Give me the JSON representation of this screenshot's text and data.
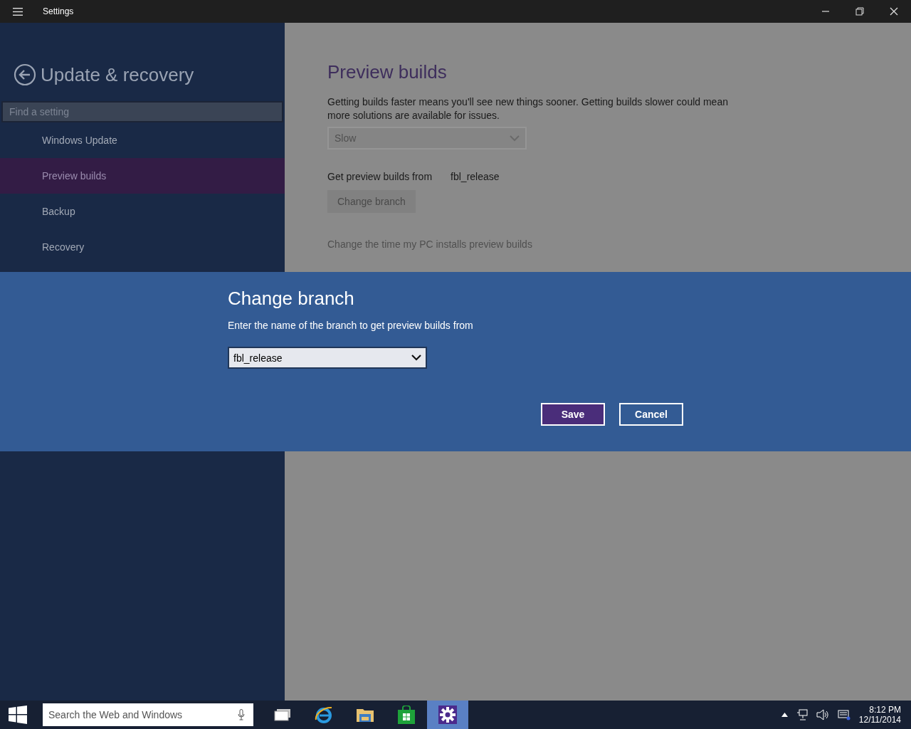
{
  "window": {
    "title": "Settings"
  },
  "sidebar": {
    "heading": "Update & recovery",
    "search": {
      "placeholder": "Find a setting"
    },
    "items": [
      {
        "label": "Windows Update",
        "selected": false
      },
      {
        "label": "Preview builds",
        "selected": true
      },
      {
        "label": "Backup",
        "selected": false
      },
      {
        "label": "Recovery",
        "selected": false
      }
    ]
  },
  "content": {
    "heading": "Preview builds",
    "description": "Getting builds faster means you'll see new things sooner. Getting builds slower could mean more solutions are available for issues.",
    "speed": {
      "value": "Slow",
      "disabled": true
    },
    "branch_label": "Get preview builds from",
    "branch_value": "fbl_release",
    "change_button": {
      "label": "Change branch",
      "disabled": true
    },
    "time_link": "Change the time my PC installs preview builds"
  },
  "dialog": {
    "title": "Change branch",
    "prompt": "Enter the name of the branch to get preview builds from",
    "branch": "fbl_release",
    "buttons": [
      {
        "label": "Save",
        "kind": "primary"
      },
      {
        "label": "Cancel",
        "kind": "secondary"
      }
    ]
  },
  "taskbar": {
    "search": {
      "placeholder": "Search the Web and Windows"
    },
    "apps": [
      {
        "kind": "taskview",
        "selected": false
      },
      {
        "kind": "browser",
        "selected": false
      },
      {
        "kind": "explorer",
        "selected": false
      },
      {
        "kind": "store",
        "selected": false
      },
      {
        "kind": "settings",
        "selected": true
      }
    ],
    "time": "8:12 PM",
    "date": "12/11/2014"
  }
}
